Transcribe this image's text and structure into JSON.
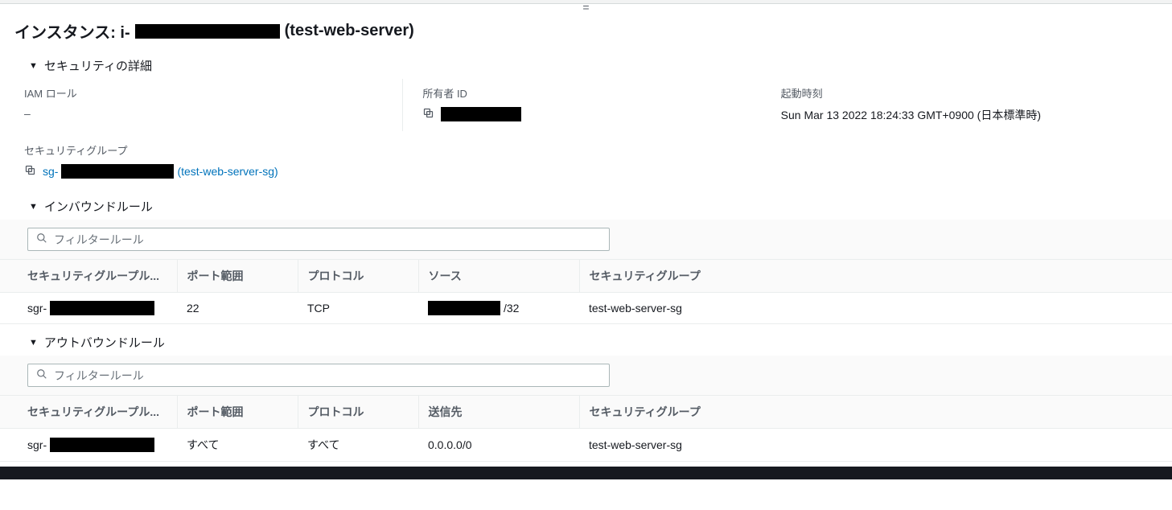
{
  "title": {
    "prefix": "インスタンス: i-",
    "suffix": "(test-web-server)"
  },
  "sections": {
    "security_details": "セキュリティの詳細",
    "inbound_rules": "インバウンドルール",
    "outbound_rules": "アウトバウンドルール"
  },
  "details": {
    "iam_role": {
      "label": "IAM ロール",
      "value": "–"
    },
    "owner_id": {
      "label": "所有者 ID"
    },
    "launch_time": {
      "label": "起動時刻",
      "value": "Sun Mar 13 2022 18:24:33 GMT+0900 (日本標準時)"
    },
    "security_groups": {
      "label": "セキュリティグループ",
      "link_prefix": "sg-",
      "name_suffix": "(test-web-server-sg)"
    }
  },
  "filter": {
    "placeholder": "フィルタールール"
  },
  "columns": {
    "sgr": "セキュリティグループル...",
    "port_range": "ポート範囲",
    "protocol": "プロトコル",
    "source": "ソース",
    "destination": "送信先",
    "sg": "セキュリティグループ"
  },
  "inbound": [
    {
      "sgr_prefix": "sgr-",
      "port": "22",
      "protocol": "TCP",
      "source_suffix": "/32",
      "sg": "test-web-server-sg"
    }
  ],
  "outbound": [
    {
      "sgr_prefix": "sgr-",
      "port": "すべて",
      "protocol": "すべて",
      "destination": "0.0.0.0/0",
      "sg": "test-web-server-sg"
    }
  ]
}
